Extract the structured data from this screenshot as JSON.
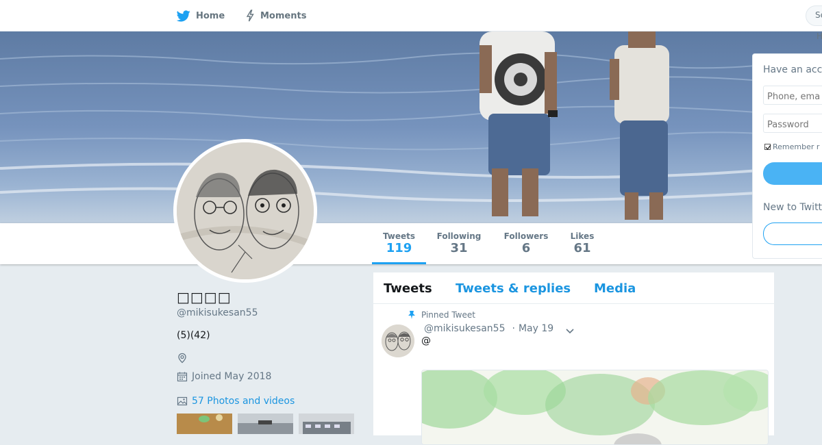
{
  "nav": {
    "home_label": "Home",
    "moments_label": "Moments",
    "search_partial": "Se",
    "have_account_partial": "H"
  },
  "stats": [
    {
      "label": "Tweets",
      "value": "119"
    },
    {
      "label": "Following",
      "value": "31"
    },
    {
      "label": "Followers",
      "value": "6"
    },
    {
      "label": "Likes",
      "value": "61"
    }
  ],
  "profile": {
    "display_name": "□□□□",
    "screen_name": "@mikisukesan55",
    "bio": "(5)(42)",
    "joined": "Joined May 2018",
    "photos_link": "57 Photos and videos"
  },
  "timeline": {
    "tabs": [
      "Tweets",
      "Tweets & replies",
      "Media"
    ],
    "pinned_label": "Pinned Tweet",
    "tweet": {
      "screen_name": "@mikisukesan55",
      "separator": "·",
      "date": "May 19",
      "text": "@"
    }
  },
  "login": {
    "title": "Have an acc",
    "phone_placeholder": "Phone, ema",
    "password_placeholder": "Password",
    "remember_label": "Remember r",
    "new_title": "New to Twitt"
  },
  "colors": {
    "accent": "#1da1f2",
    "link": "#1b95e0",
    "background": "#e6ecf0"
  }
}
